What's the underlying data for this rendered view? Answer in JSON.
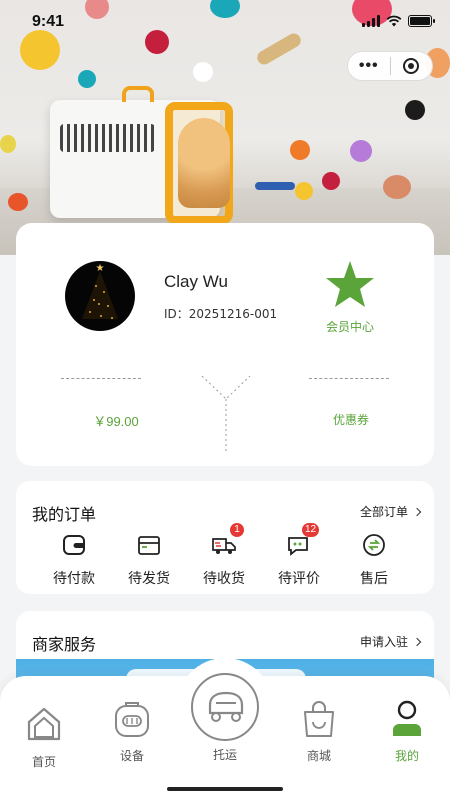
{
  "status_bar": {
    "time": "9:41"
  },
  "capsule": {
    "more_icon": "more-dots-icon",
    "close_icon": "target-icon"
  },
  "profile": {
    "name": "Clay Wu",
    "id_text": "ID：20251216-001",
    "member_label": "会员中心",
    "balance": "￥99.00",
    "coupon_label": "优惠券",
    "accent_color": "#5aa43a"
  },
  "orders": {
    "title": "我的订单",
    "all_link": "全部订单",
    "items": [
      {
        "label": "待付款",
        "icon": "wallet-icon"
      },
      {
        "label": "待发货",
        "icon": "box-icon"
      },
      {
        "label": "待收货",
        "icon": "truck-icon",
        "badge": "1"
      },
      {
        "label": "待评价",
        "icon": "chat-icon",
        "badge": "12"
      },
      {
        "label": "售后",
        "icon": "after-sale-icon"
      }
    ]
  },
  "merchant": {
    "title": "商家服务",
    "apply_link": "申请入驻"
  },
  "tabbar": {
    "items": [
      {
        "label": "首页",
        "icon": "home-icon"
      },
      {
        "label": "设备",
        "icon": "carrier-icon"
      },
      {
        "label": "托运",
        "icon": "car-icon"
      },
      {
        "label": "商城",
        "icon": "shopping-bag-icon"
      },
      {
        "label": "我的",
        "icon": "user-icon",
        "active": true
      }
    ]
  }
}
